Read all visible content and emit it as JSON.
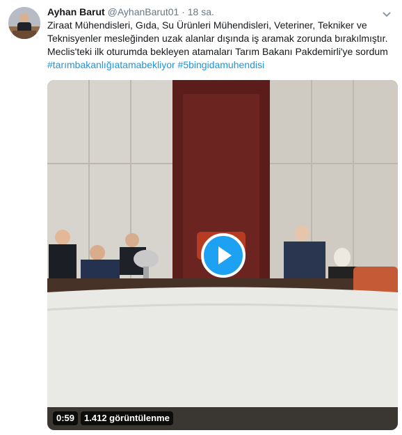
{
  "tweet": {
    "author_name": "Ayhan Barut",
    "author_handle": "@AyhanBarut01",
    "separator": "·",
    "time": "18 sa.",
    "text_line1": "Ziraat Mühendisleri, Gıda, Su Ürünleri Mühendisleri, Veteriner, Tekniker ve Teknisyenler mesleğinden uzak alanlar dışında iş aramak zorunda bırakılmıştır.",
    "text_line2": "Meclis'teki ilk oturumda bekleyen atamaları Tarım Bakanı Pakdemirli'ye sordum",
    "hashtag1": "#tarımbakanlığıatamabekliyor",
    "hashtag2": "#5bingidamuhendisi"
  },
  "video": {
    "duration": "0:59",
    "views": "1.412 görüntülenme"
  },
  "colors": {
    "link": "#1b95e0",
    "play_button": "#1da1f2",
    "text": "#14171a",
    "muted": "#657786"
  },
  "icons": {
    "play": "play-icon",
    "caret": "chevron-down-icon"
  }
}
